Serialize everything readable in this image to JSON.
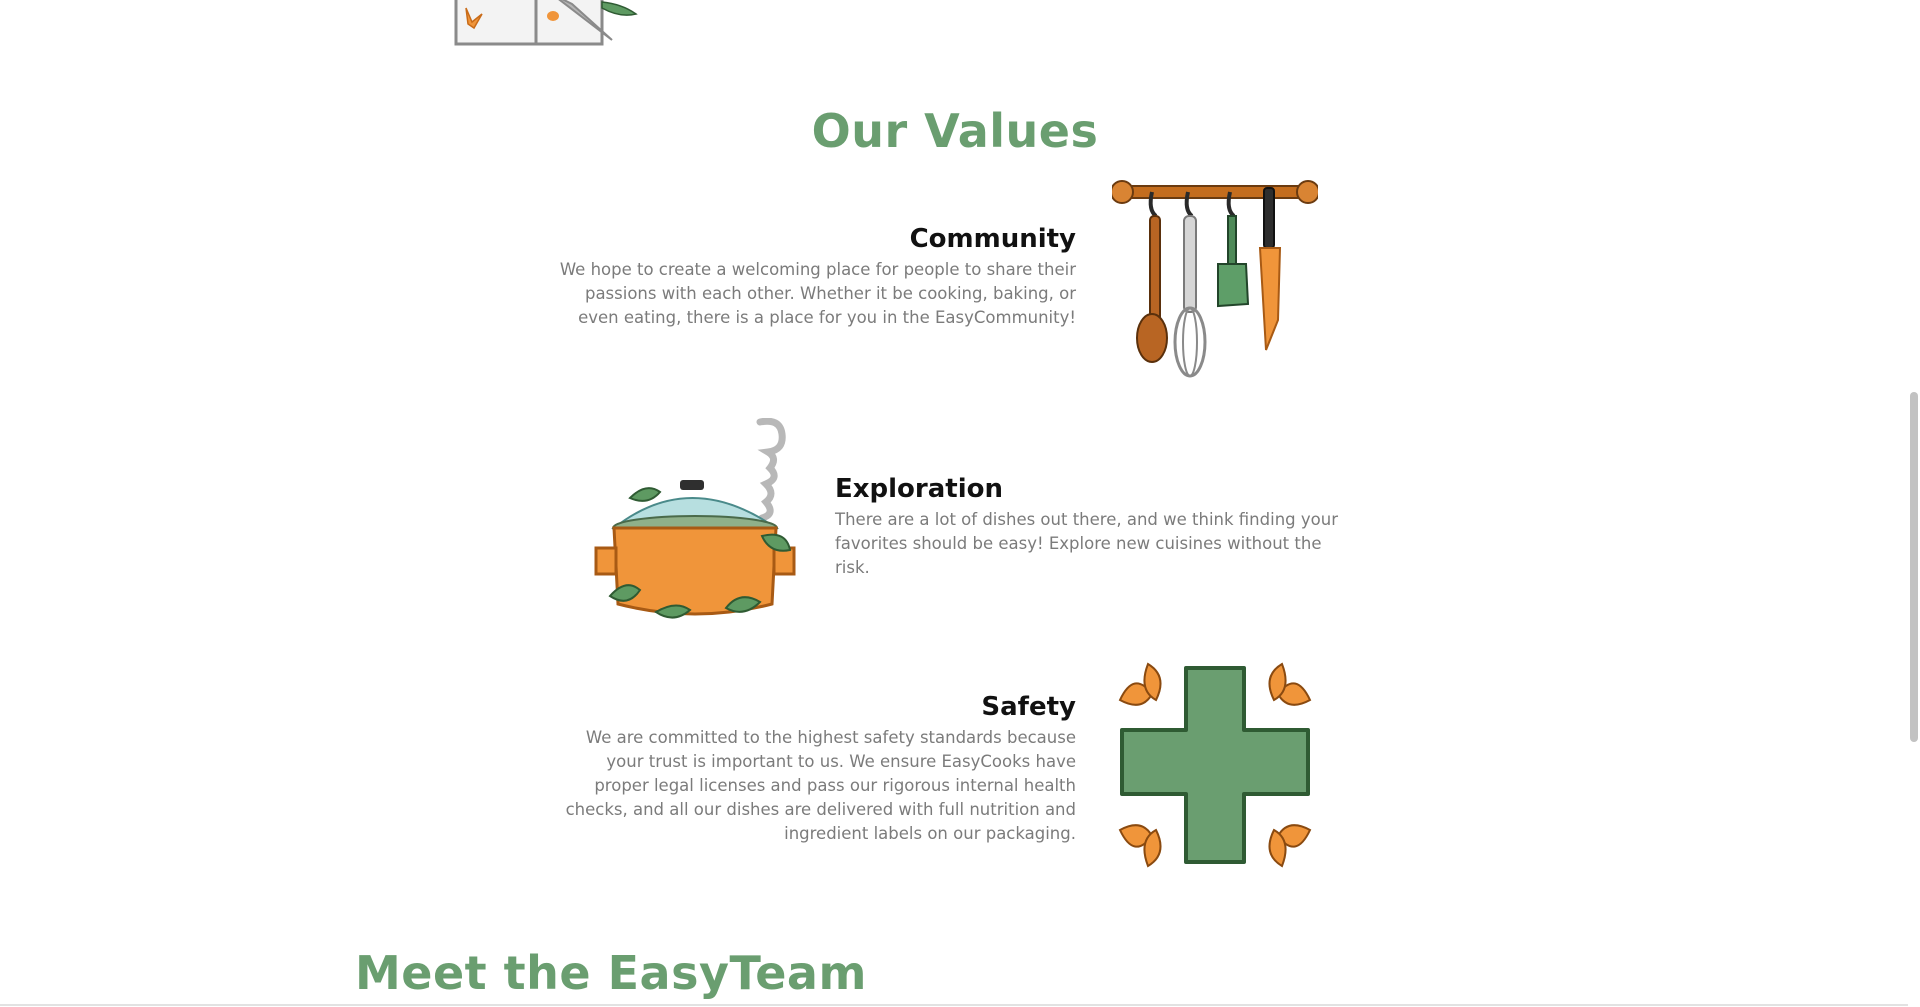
{
  "values_section": {
    "title": "Our Values",
    "items": [
      {
        "heading": "Community",
        "text": "We hope to create a welcoming place for people to share their passions with each other. Whether it be cooking, baking, or even eating, there is a place for you in the EasyCommunity!",
        "image": "hanging-utensils-illustration"
      },
      {
        "heading": "Exploration",
        "text": "There are a lot of dishes out there, and we think finding your favorites should be easy! Explore new cuisines without the risk.",
        "image": "cooking-pot-illustration"
      },
      {
        "heading": "Safety",
        "text": "We are committed to the highest safety standards because your trust is important to us. We ensure EasyCooks have proper legal licenses and pass our rigorous internal health checks, and all our dishes are delivered with full nutrition and ingredient labels on our packaging.",
        "image": "health-cross-illustration"
      }
    ]
  },
  "team_section": {
    "title": "Meet the EasyTeam"
  },
  "colors": {
    "accent_green": "#6a9e70",
    "heading_text": "#111111",
    "body_text": "#7b7b7b",
    "orange": "#f0953a"
  }
}
